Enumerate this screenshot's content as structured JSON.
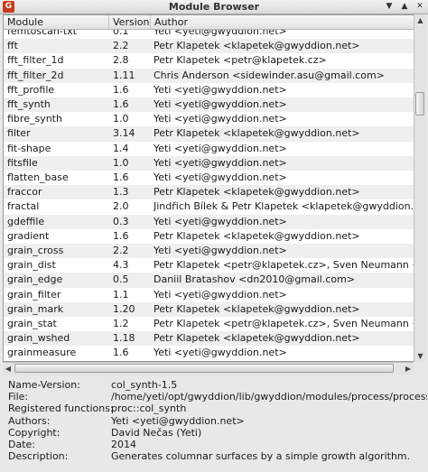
{
  "window": {
    "title": "Module Browser",
    "icon": "gwyddion-app-icon"
  },
  "columns": {
    "module": "Module",
    "version": "Version",
    "author": "Author"
  },
  "rows": [
    {
      "module": "femtoscan-txt",
      "version": "0.1",
      "author": "Yeti <yeti@gwyddion.net>"
    },
    {
      "module": "fft",
      "version": "2.2",
      "author": "Petr Klapetek <klapetek@gwyddion.net>"
    },
    {
      "module": "fft_filter_1d",
      "version": "2.8",
      "author": "Petr Klapetek <petr@klapetek.cz>"
    },
    {
      "module": "fft_filter_2d",
      "version": "1.11",
      "author": "Chris Anderson <sidewinder.asu@gmail.com>"
    },
    {
      "module": "fft_profile",
      "version": "1.6",
      "author": "Yeti <yeti@gwyddion.net>"
    },
    {
      "module": "fft_synth",
      "version": "1.6",
      "author": "Yeti <yeti@gwyddion.net>"
    },
    {
      "module": "fibre_synth",
      "version": "1.0",
      "author": "Yeti <yeti@gwyddion.net>"
    },
    {
      "module": "filter",
      "version": "3.14",
      "author": "Petr Klapetek <klapetek@gwyddion.net>"
    },
    {
      "module": "fit-shape",
      "version": "1.4",
      "author": "Yeti <yeti@gwyddion.net>"
    },
    {
      "module": "fitsfile",
      "version": "1.0",
      "author": "Yeti <yeti@gwyddion.net>"
    },
    {
      "module": "flatten_base",
      "version": "1.6",
      "author": "Yeti <yeti@gwyddion.net>"
    },
    {
      "module": "fraccor",
      "version": "1.3",
      "author": "Petr Klapetek <klapetek@gwyddion.net>"
    },
    {
      "module": "fractal",
      "version": "2.0",
      "author": "Jindřich Bílek & Petr Klapetek <klapetek@gwyddion.net>"
    },
    {
      "module": "gdeffile",
      "version": "0.3",
      "author": "Yeti <yeti@gwyddion.net>"
    },
    {
      "module": "gradient",
      "version": "1.6",
      "author": "Petr Klapetek <klapetek@gwyddion.net>"
    },
    {
      "module": "grain_cross",
      "version": "2.2",
      "author": "Yeti <yeti@gwyddion.net>"
    },
    {
      "module": "grain_dist",
      "version": "4.3",
      "author": "Petr Klapetek <petr@klapetek.cz>, Sven Neumann <neumann@jpk.com>"
    },
    {
      "module": "grain_edge",
      "version": "0.5",
      "author": "Daniil Bratashov <dn2010@gmail.com>"
    },
    {
      "module": "grain_filter",
      "version": "1.1",
      "author": "Yeti <yeti@gwyddion.net>"
    },
    {
      "module": "grain_mark",
      "version": "1.20",
      "author": "Petr Klapetek <klapetek@gwyddion.net>"
    },
    {
      "module": "grain_stat",
      "version": "1.2",
      "author": "Petr Klapetek <petr@klapetek.cz>, Sven Neumann <neumann@jpk.com>"
    },
    {
      "module": "grain_wshed",
      "version": "1.18",
      "author": "Petr Klapetek <klapetek@gwyddion.net>"
    },
    {
      "module": "grainmeasure",
      "version": "1.6",
      "author": "Yeti <yeti@gwyddion.net>"
    }
  ],
  "details": [
    {
      "label": "Name-Version:",
      "value": "col_synth-1.5"
    },
    {
      "label": "File:",
      "value": "/home/yeti/opt/gwyddion/lib/gwyddion/modules/process/process.so"
    },
    {
      "label": "Registered functions:",
      "value": "proc::col_synth"
    },
    {
      "label": "Authors:",
      "value": "Yeti <yeti@gwyddion.net>"
    },
    {
      "label": "Copyright:",
      "value": "David Nečas (Yeti)"
    },
    {
      "label": "Date:",
      "value": "2014"
    },
    {
      "label": "Description:",
      "value": "Generates columnar surfaces by a simple growth algorithm."
    }
  ]
}
